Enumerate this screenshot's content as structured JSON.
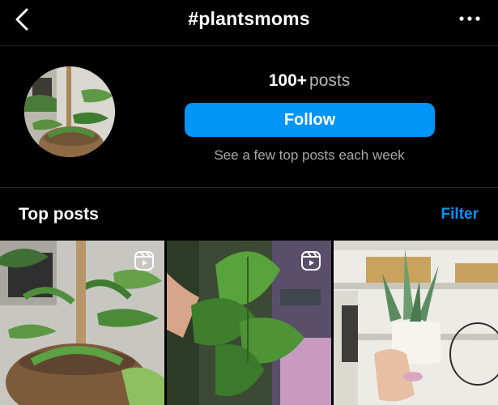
{
  "header": {
    "title": "#plantsmoms",
    "back_icon": "chevron-left-icon",
    "more_icon": "more-horizontal-icon"
  },
  "profile": {
    "post_count": "100+",
    "post_count_label": "posts",
    "follow_label": "Follow",
    "subtitle": "See a few top posts each week"
  },
  "top_posts": {
    "title": "Top posts",
    "filter_label": "Filter"
  },
  "colors": {
    "accent": "#0095f6",
    "background": "#000000",
    "secondary_text": "#a8a8a8"
  }
}
